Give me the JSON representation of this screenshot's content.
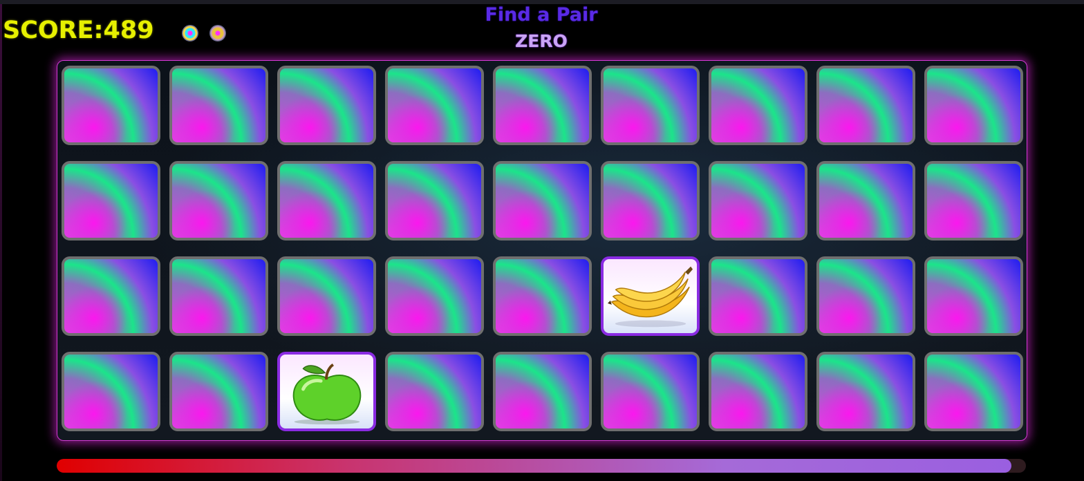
{
  "header": {
    "score_label": "SCORE:489",
    "title": "Find a Pair",
    "subtitle": "ZERO"
  },
  "powerups": [
    {
      "icon": "swirl-orb-icon"
    },
    {
      "icon": "gold-orb-icon"
    }
  ],
  "board": {
    "rows": 4,
    "columns": 9,
    "revealed_cards": [
      {
        "row": 3,
        "col": 6,
        "content": "banana"
      },
      {
        "row": 4,
        "col": 3,
        "content": "green-apple"
      }
    ]
  },
  "timer": {
    "fill_fraction": 0.985
  },
  "colors": {
    "score": "#e6f000",
    "title": "#5a2ae6",
    "board_border": "#d63ad6",
    "card_border": "#6f6f6f",
    "revealed_border": "#8a2be2"
  }
}
